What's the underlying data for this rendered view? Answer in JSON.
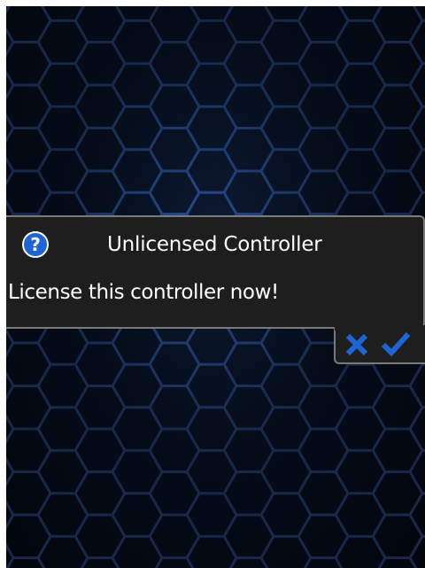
{
  "dialog": {
    "title": "Unlicensed Controller",
    "message": "License this controller now!",
    "icon": "question-icon",
    "cancel_icon": "close-icon",
    "confirm_icon": "checkmark-icon"
  },
  "colors": {
    "background": "#050c19",
    "hex_line": "#1a2d4e",
    "hex_glow": "#2f6bd8",
    "dialog_bg": "#1e1e1e",
    "dialog_border": "#7a7a7a",
    "accent_blue": "#1f64d6",
    "text": "#ffffff"
  }
}
